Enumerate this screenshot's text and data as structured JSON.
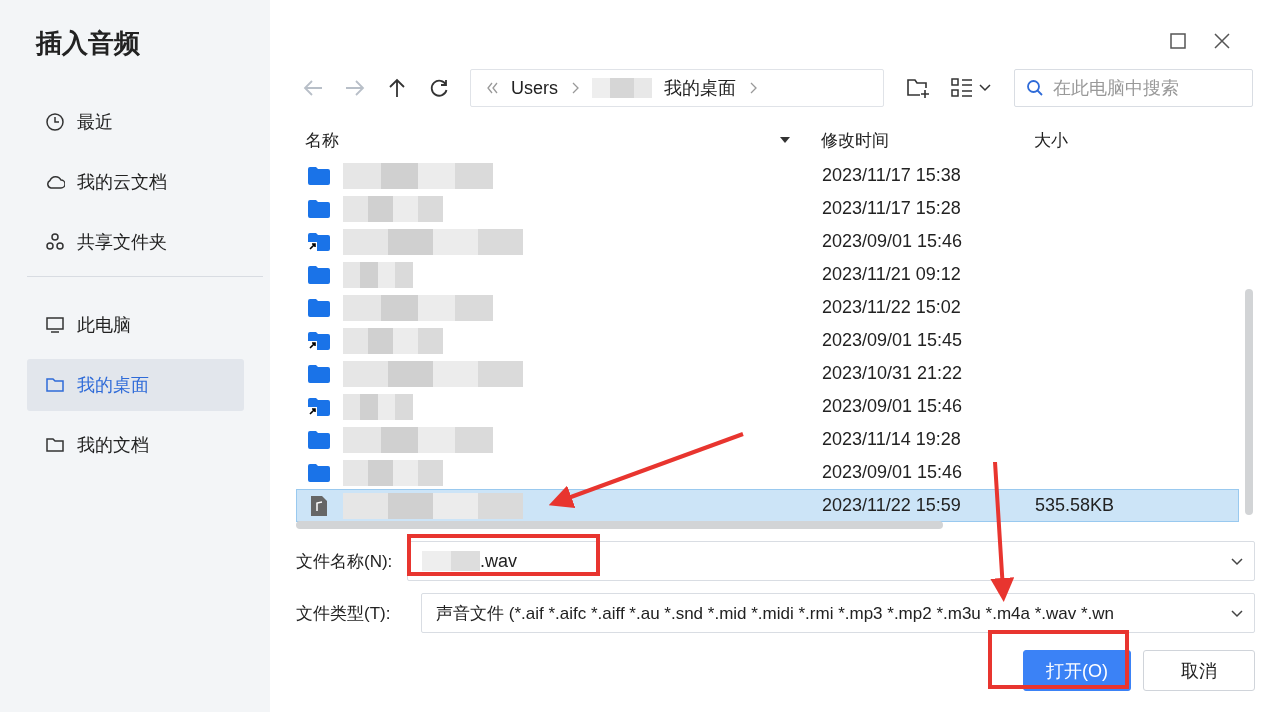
{
  "window": {
    "title": "插入音频"
  },
  "sidebar": {
    "items": [
      {
        "label": "最近",
        "kind": "clock",
        "selected": false
      },
      {
        "label": "我的云文档",
        "kind": "cloud",
        "selected": false
      },
      {
        "label": "共享文件夹",
        "kind": "share",
        "selected": false
      },
      {
        "label": "此电脑",
        "kind": "monitor",
        "selected": false,
        "group_start": true
      },
      {
        "label": "我的桌面",
        "kind": "folder",
        "selected": true
      },
      {
        "label": "我的文档",
        "kind": "folder",
        "selected": false
      }
    ]
  },
  "breadcrumb": [
    "Users",
    "我的桌面"
  ],
  "search": {
    "placeholder": "在此电脑中搜索"
  },
  "table": {
    "columns": [
      "名称",
      "修改时间",
      "大小"
    ],
    "rows": [
      {
        "kind": "folder",
        "modified": "2023/11/17 15:38",
        "selected": false
      },
      {
        "kind": "folder",
        "modified": "2023/11/17 15:28",
        "selected": false
      },
      {
        "kind": "shortcut",
        "modified": "2023/09/01 15:46",
        "selected": false
      },
      {
        "kind": "folder",
        "modified": "2023/11/21 09:12",
        "selected": false
      },
      {
        "kind": "folder",
        "modified": "2023/11/22 15:02",
        "selected": false
      },
      {
        "kind": "shortcut",
        "modified": "2023/09/01 15:45",
        "selected": false
      },
      {
        "kind": "folder",
        "modified": "2023/10/31 21:22",
        "selected": false
      },
      {
        "kind": "shortcut",
        "modified": "2023/09/01 15:46",
        "selected": false
      },
      {
        "kind": "folder",
        "modified": "2023/11/14 19:28",
        "selected": false
      },
      {
        "kind": "folder",
        "modified": "2023/09/01 15:46",
        "selected": false
      },
      {
        "kind": "audio",
        "modified": "2023/11/22 15:59",
        "size": "535.58KB",
        "selected": true
      }
    ]
  },
  "file_name": {
    "label": "文件名称(N):",
    "value": ".wav"
  },
  "file_type": {
    "label": "文件类型(T):",
    "value": "声音文件 (*.aif *.aifc *.aiff *.au *.snd *.mid *.midi *.rmi *.mp3 *.mp2 *.m3u *.m4a *.wav *.wn"
  },
  "buttons": [
    {
      "label": "打开(O)",
      "kind": "primary"
    },
    {
      "label": "取消",
      "kind": "secondary"
    }
  ]
}
